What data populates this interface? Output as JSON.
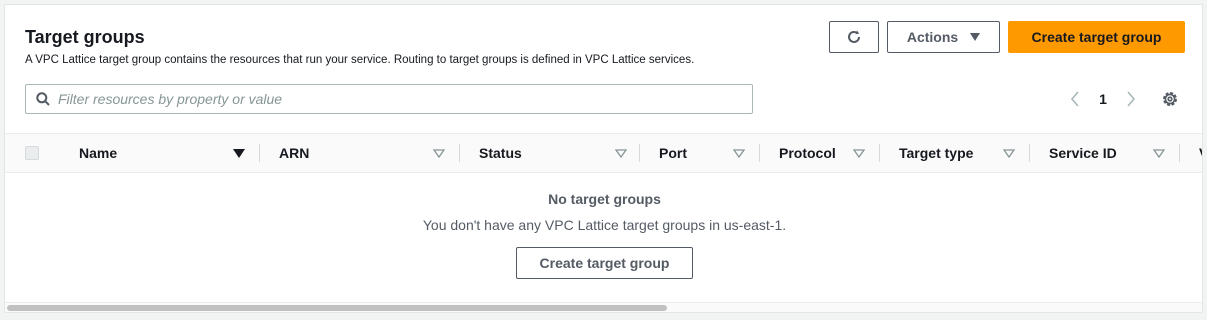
{
  "header": {
    "title": "Target groups",
    "description": "A VPC Lattice target group contains the resources that run your service. Routing to target groups is defined in VPC Lattice services."
  },
  "toolbar": {
    "refresh_icon": "refresh-icon",
    "actions_label": "Actions",
    "create_label": "Create target group"
  },
  "filter": {
    "placeholder": "Filter resources by property or value",
    "value": ""
  },
  "pagination": {
    "current_page": "1"
  },
  "table": {
    "columns": [
      {
        "label": "Name"
      },
      {
        "label": "ARN"
      },
      {
        "label": "Status"
      },
      {
        "label": "Port"
      },
      {
        "label": "Protocol"
      },
      {
        "label": "Target type"
      },
      {
        "label": "Service ID"
      },
      {
        "label": "V"
      }
    ],
    "empty": {
      "title": "No target groups",
      "message": "You don't have any VPC Lattice target groups in us-east-1.",
      "button_label": "Create target group"
    }
  },
  "colors": {
    "primary": "#ff9900",
    "text": "#16191f",
    "secondary_text": "#545b64"
  }
}
